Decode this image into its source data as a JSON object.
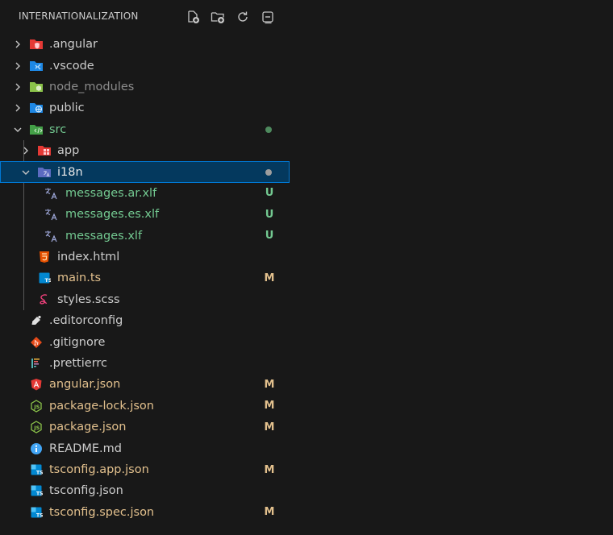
{
  "header": {
    "title": "INTERNATIONALIZATION",
    "actions": [
      "new-file-icon",
      "new-folder-icon",
      "refresh-icon",
      "collapse-all-icon"
    ]
  },
  "colors": {
    "background": "#181818",
    "selected_bg": "#04395e",
    "untracked_green": "#73c991",
    "modified_yellow": "#e2c08d",
    "ignored_gray": "#8c8c8c",
    "default_text": "#cccccc"
  },
  "tree": [
    {
      "label": ".angular",
      "type": "folder",
      "expanded": false,
      "icon": "angular-folder-icon"
    },
    {
      "label": ".vscode",
      "type": "folder",
      "expanded": false,
      "icon": "vscode-folder-icon"
    },
    {
      "label": "node_modules",
      "type": "folder",
      "expanded": false,
      "icon": "node-folder-icon"
    },
    {
      "label": "public",
      "type": "folder",
      "expanded": false,
      "icon": "public-folder-icon"
    },
    {
      "label": "src",
      "type": "folder",
      "expanded": true,
      "icon": "src-folder-icon",
      "status_dot": true
    },
    {
      "label": "app",
      "type": "folder",
      "expanded": false,
      "icon": "app-folder-icon"
    },
    {
      "label": "i18n",
      "type": "folder",
      "expanded": true,
      "icon": "i18n-folder-icon",
      "status_dot": true,
      "selected": true
    },
    {
      "label": "messages.ar.xlf",
      "type": "file",
      "icon": "translate-icon",
      "status": "U"
    },
    {
      "label": "messages.es.xlf",
      "type": "file",
      "icon": "translate-icon",
      "status": "U"
    },
    {
      "label": "messages.xlf",
      "type": "file",
      "icon": "translate-icon",
      "status": "U"
    },
    {
      "label": "index.html",
      "type": "file",
      "icon": "html-icon"
    },
    {
      "label": "main.ts",
      "type": "file",
      "icon": "typescript-icon",
      "status": "M"
    },
    {
      "label": "styles.scss",
      "type": "file",
      "icon": "sass-icon"
    },
    {
      "label": ".editorconfig",
      "type": "file",
      "icon": "editorconfig-icon"
    },
    {
      "label": ".gitignore",
      "type": "file",
      "icon": "git-icon"
    },
    {
      "label": ".prettierrc",
      "type": "file",
      "icon": "prettier-icon"
    },
    {
      "label": "angular.json",
      "type": "file",
      "icon": "angular-icon",
      "status": "M"
    },
    {
      "label": "package-lock.json",
      "type": "file",
      "icon": "nodejs-icon",
      "status": "M"
    },
    {
      "label": "package.json",
      "type": "file",
      "icon": "nodejs-icon",
      "status": "M"
    },
    {
      "label": "README.md",
      "type": "file",
      "icon": "info-icon"
    },
    {
      "label": "tsconfig.app.json",
      "type": "file",
      "icon": "tsconfig-icon",
      "status": "M"
    },
    {
      "label": "tsconfig.json",
      "type": "file",
      "icon": "tsconfig-icon"
    },
    {
      "label": "tsconfig.spec.json",
      "type": "file",
      "icon": "tsconfig-icon",
      "status": "M"
    }
  ]
}
